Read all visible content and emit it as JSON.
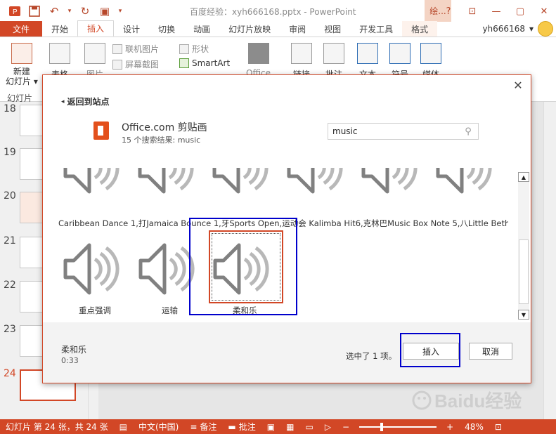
{
  "window": {
    "title": "百度经验：xyh666168.pptx - PowerPoint",
    "context_tab_top": "绘...",
    "win_controls": [
      "?",
      "⊡",
      "—",
      "▢",
      "✕"
    ]
  },
  "ribbon_tabs": [
    "文件",
    "开始",
    "插入",
    "设计",
    "切换",
    "动画",
    "幻灯片放映",
    "审阅",
    "视图",
    "开发工具",
    "格式"
  ],
  "active_tab": "插入",
  "user": {
    "name": "yh666168",
    "chevron": "▾"
  },
  "ribbon": {
    "new_slide_label": "新建\n幻灯片",
    "new_slide_sub": "▾",
    "table_label": "表格",
    "picture_label": "图片",
    "online_picture": "联机图片",
    "screenshot": "屏幕截图",
    "shapes": "形状",
    "smartart": "SmartArt",
    "office_label": "Office",
    "link_label": "链接",
    "comment_label": "批注",
    "text_label": "文本",
    "symbol_label": "符号",
    "media_label": "媒体",
    "group_slides": "幻灯片"
  },
  "slides": [
    {
      "num": "18"
    },
    {
      "num": "19"
    },
    {
      "num": "20"
    },
    {
      "num": "21"
    },
    {
      "num": "22"
    },
    {
      "num": "23"
    },
    {
      "num": "24"
    }
  ],
  "dialog": {
    "back_label": "返回到站点",
    "source_title": "Office.com 剪贴画",
    "source_sub": "15 个搜索结果: music",
    "search_value": "music",
    "row1_caption": "Caribbean Dance 1,打Jamaica Bounce 1,牙Sports Open,运动会 Kalimba Hit6,克林巴Music Box Note 5,八Little Bethlehem,伯利",
    "row2": [
      {
        "label": "重点强调"
      },
      {
        "label": "运输"
      },
      {
        "label": "柔和乐"
      }
    ],
    "selected_name": "柔和乐",
    "selected_duration": "0:33",
    "selected_count": "选中了 1 项。",
    "insert_button": "插入",
    "cancel_button": "取消",
    "close": "✕"
  },
  "statusbar": {
    "slide_info": "幻灯片 第 24 张，共 24 张",
    "language": "中文(中国)",
    "notes": "备注",
    "comments": "批注",
    "zoom": "48%"
  },
  "watermark": "Baidu经验"
}
